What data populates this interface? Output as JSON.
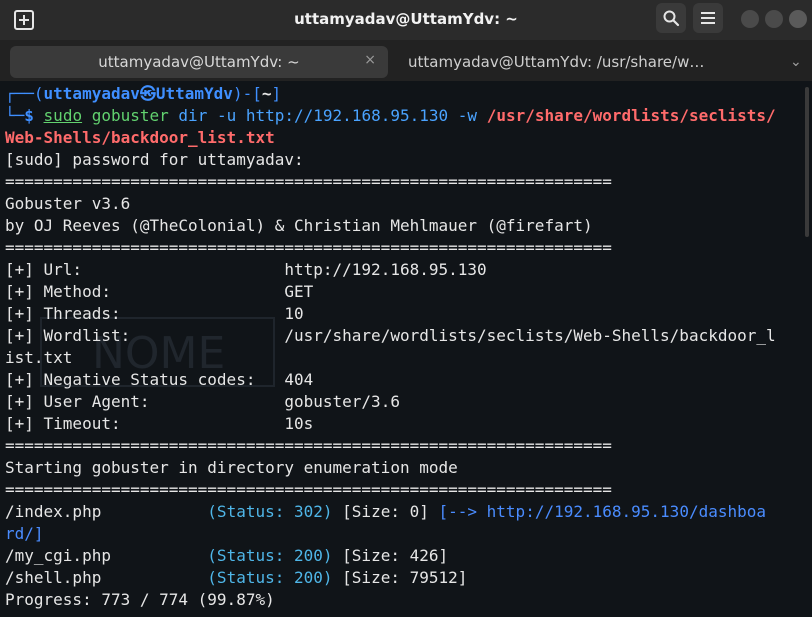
{
  "window": {
    "title": "uttamyadav@UttamYdv: ~",
    "tabs": [
      {
        "label": "uttamyadav@UttamYdv: ~",
        "close": "×"
      },
      {
        "label": "uttamyadav@UttamYdv: /usr/share/w…"
      }
    ],
    "tab_overflow": "⌄"
  },
  "colors": {
    "prompt": "#3f8fff",
    "command": "#62d26f",
    "wordlist_path": "#ff6b6b",
    "status": "#4fb6e8",
    "background": "#101418"
  },
  "terminal": {
    "watermark": "NOME",
    "prompt": {
      "line1_prefix": "┌──(",
      "user": "uttamyadav",
      "at": "㉿",
      "host": "UttamYdv",
      "line1_mid": ")-[",
      "cwd": "~",
      "line1_suffix": "]",
      "line2_prefix": "└─",
      "symbol": "$",
      "cmd_sudo": "sudo",
      "cmd_tool": "gobuster",
      "cmd_args": "dir -u http://192.168.95.130 -w",
      "wordlist_line1": "/usr/share/wordlists/seclists/",
      "wordlist_line2": "Web-Shells/backdoor_list.txt"
    },
    "sudo_prompt": "[sudo] password for uttamyadav:",
    "separator": "===============================================================",
    "banner": [
      "Gobuster v3.6",
      "by OJ Reeves (@TheColonial) & Christian Mehlmauer (@firefart)"
    ],
    "config": [
      {
        "label": "[+] Url:                     ",
        "value": "http://192.168.95.130"
      },
      {
        "label": "[+] Method:                  ",
        "value": "GET"
      },
      {
        "label": "[+] Threads:                 ",
        "value": "10"
      },
      {
        "label": "[+] Wordlist:                ",
        "value": "/usr/share/wordlists/seclists/Web-Shells/backdoor_l",
        "value_cont": "ist.txt"
      },
      {
        "label": "[+] Negative Status codes:   ",
        "value": "404"
      },
      {
        "label": "[+] User Agent:              ",
        "value": "gobuster/3.6"
      },
      {
        "label": "[+] Timeout:                 ",
        "value": "10s"
      }
    ],
    "mode_line": "Starting gobuster in directory enumeration mode",
    "results": [
      {
        "path": "/index.php           ",
        "status": "(Status: 302)",
        "size": " [Size: 0]",
        "redirect": " [--> http://192.168.95.130/dashboa",
        "redirect_cont": "rd/]"
      },
      {
        "path": "/my_cgi.php          ",
        "status": "(Status: 200)",
        "size": " [Size: 426]"
      },
      {
        "path": "/shell.php           ",
        "status": "(Status: 200)",
        "size": " [Size: 79512]"
      }
    ],
    "progress": "Progress: 773 / 774 (99.87%)"
  }
}
